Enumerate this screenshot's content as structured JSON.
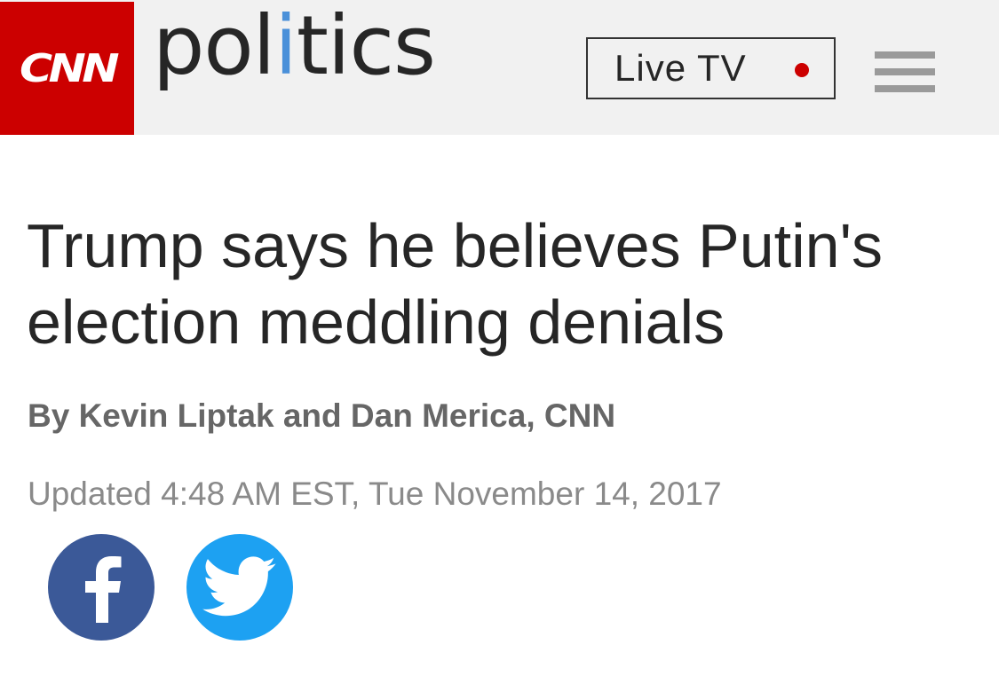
{
  "header": {
    "logo_text": "CNN",
    "section_title_part1": "pol",
    "section_title_accent": "i",
    "section_title_part2": "tics",
    "live_tv_label": "Live TV",
    "colors": {
      "brand_red": "#cc0000",
      "header_bg": "#f1f1f1",
      "accent_blue": "#4a90d9"
    }
  },
  "article": {
    "headline": "Trump says he believes Putin's election meddling denials",
    "byline": "By Kevin Liptak and Dan Merica, CNN",
    "updated": "Updated 4:48 AM EST, Tue November 14, 2017"
  },
  "share": {
    "icons": [
      "facebook-icon",
      "twitter-icon"
    ],
    "colors": {
      "facebook": "#3b5998",
      "twitter": "#1da1f2"
    }
  }
}
